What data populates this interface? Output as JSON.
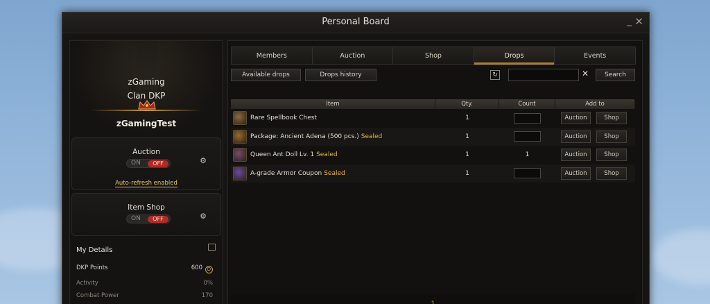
{
  "window": {
    "title": "Personal Board"
  },
  "left": {
    "hero": {
      "line1": "zGaming",
      "line2": "Clan DKP",
      "name": "zGamingTest"
    },
    "auction": {
      "title": "Auction",
      "on": "ON",
      "off": "OFF",
      "autorefresh": "Auto-refresh enabled"
    },
    "itemshop": {
      "title": "Item Shop",
      "on": "ON",
      "off": "OFF"
    },
    "details": {
      "heading": "My Details",
      "dkp_label": "DKP Points",
      "dkp_value": "600",
      "activity_label": "Activity",
      "activity_value": "0%",
      "combat_label": "Combat Power",
      "combat_value": "170"
    }
  },
  "tabs": [
    "Members",
    "Auction",
    "Shop",
    "Drops",
    "Events"
  ],
  "active_tab": "Drops",
  "subbar": {
    "available": "Available drops",
    "history": "Drops history",
    "search_btn": "Search",
    "search_value": ""
  },
  "table": {
    "headers": [
      "Item",
      "Qty.",
      "Count",
      "Add to"
    ],
    "rows": [
      {
        "name": "Rare Spellbook Chest",
        "sealed": "",
        "qty": "1",
        "count": "",
        "icon": "chest-icon",
        "color": "#8a6a3a"
      },
      {
        "name": "Package: Ancient Adena (500 pcs.)",
        "sealed": "Sealed",
        "qty": "1",
        "count": "",
        "icon": "package-icon",
        "color": "#9a6a2a"
      },
      {
        "name": "Queen Ant Doll Lv. 1",
        "sealed": "Sealed",
        "qty": "1",
        "count": "1",
        "icon": "doll-icon",
        "color": "#7a4a6a"
      },
      {
        "name": "A-grade Armor Coupon",
        "sealed": "Sealed",
        "qty": "1",
        "count": "",
        "icon": "coupon-icon",
        "color": "#6a4aa0"
      }
    ],
    "auction_label": "Auction",
    "shop_label": "Shop"
  },
  "page": "1"
}
